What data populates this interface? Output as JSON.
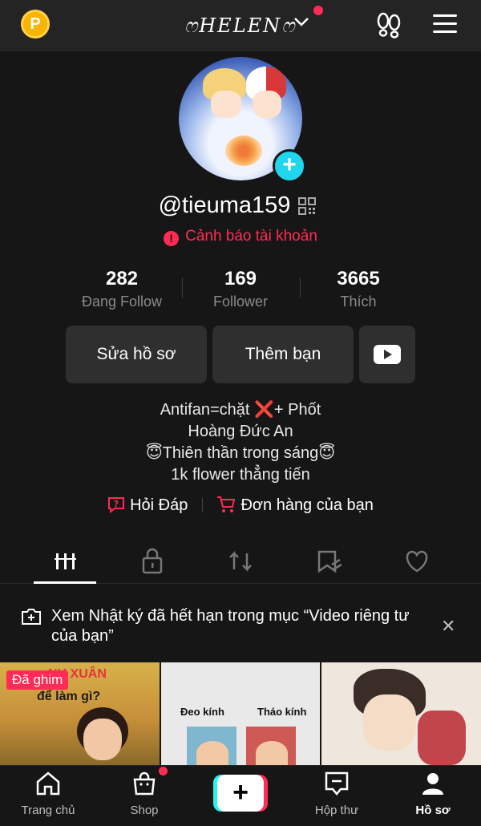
{
  "topbar": {
    "coin_label": "P",
    "account_name": "ෆHELENෆ",
    "account_switch_icon": "chevron-down-icon",
    "footprint_icon": "footprint-icon",
    "menu_icon": "hamburger-menu-icon"
  },
  "profile": {
    "username": "@tieuma159",
    "warning_text": "Cảnh báo tài khoản",
    "warning_icon": "!",
    "add_avatar_label": "+",
    "stats": [
      {
        "value": "282",
        "label": "Đang Follow"
      },
      {
        "value": "169",
        "label": "Follower"
      },
      {
        "value": "3665",
        "label": "Thích"
      }
    ],
    "buttons": {
      "edit_profile": "Sửa hồ sơ",
      "add_friends": "Thêm bạn",
      "youtube_icon": "youtube-icon"
    },
    "bio_lines": [
      "Antifan=chặt ❌+ Phốt",
      "Hoàng Đức An",
      "😇Thiên thần trong sáng😇",
      "1k flower thẳng tiến"
    ],
    "links": {
      "qa": "Hỏi Đáp",
      "orders": "Đơn hàng của bạn"
    }
  },
  "tabs": [
    {
      "name": "videos",
      "icon": "grid-icon",
      "active": true
    },
    {
      "name": "private",
      "icon": "lock-icon",
      "active": false
    },
    {
      "name": "reposts",
      "icon": "repost-icon",
      "active": false
    },
    {
      "name": "favorites",
      "icon": "bookmark-icon",
      "active": false
    },
    {
      "name": "liked",
      "icon": "heart-icon",
      "active": false
    }
  ],
  "notice": {
    "text": "Xem Nhật ký đã hết hạn trong mục “Video riêng tư của bạn”",
    "close_label": "✕"
  },
  "videos": [
    {
      "badge": "Đã ghim",
      "overlay_title": "NH XUÂN",
      "overlay_sub": "để làm gì?"
    },
    {
      "label_left": "Đeo kính",
      "label_right": "Tháo kính"
    },
    {}
  ],
  "bottom_nav": [
    {
      "label": "Trang chủ",
      "icon": "home-icon"
    },
    {
      "label": "Shop",
      "icon": "shop-bag-icon"
    },
    {
      "label": "+",
      "icon": "create-plus-icon"
    },
    {
      "label": "Hộp thư",
      "icon": "inbox-icon"
    },
    {
      "label": "Hồ sơ",
      "icon": "profile-icon",
      "active": true
    }
  ],
  "colors": {
    "accent_red": "#fe2c55",
    "accent_cyan": "#25f4ee",
    "background": "#161616",
    "button_bg": "#2f2f2f"
  }
}
